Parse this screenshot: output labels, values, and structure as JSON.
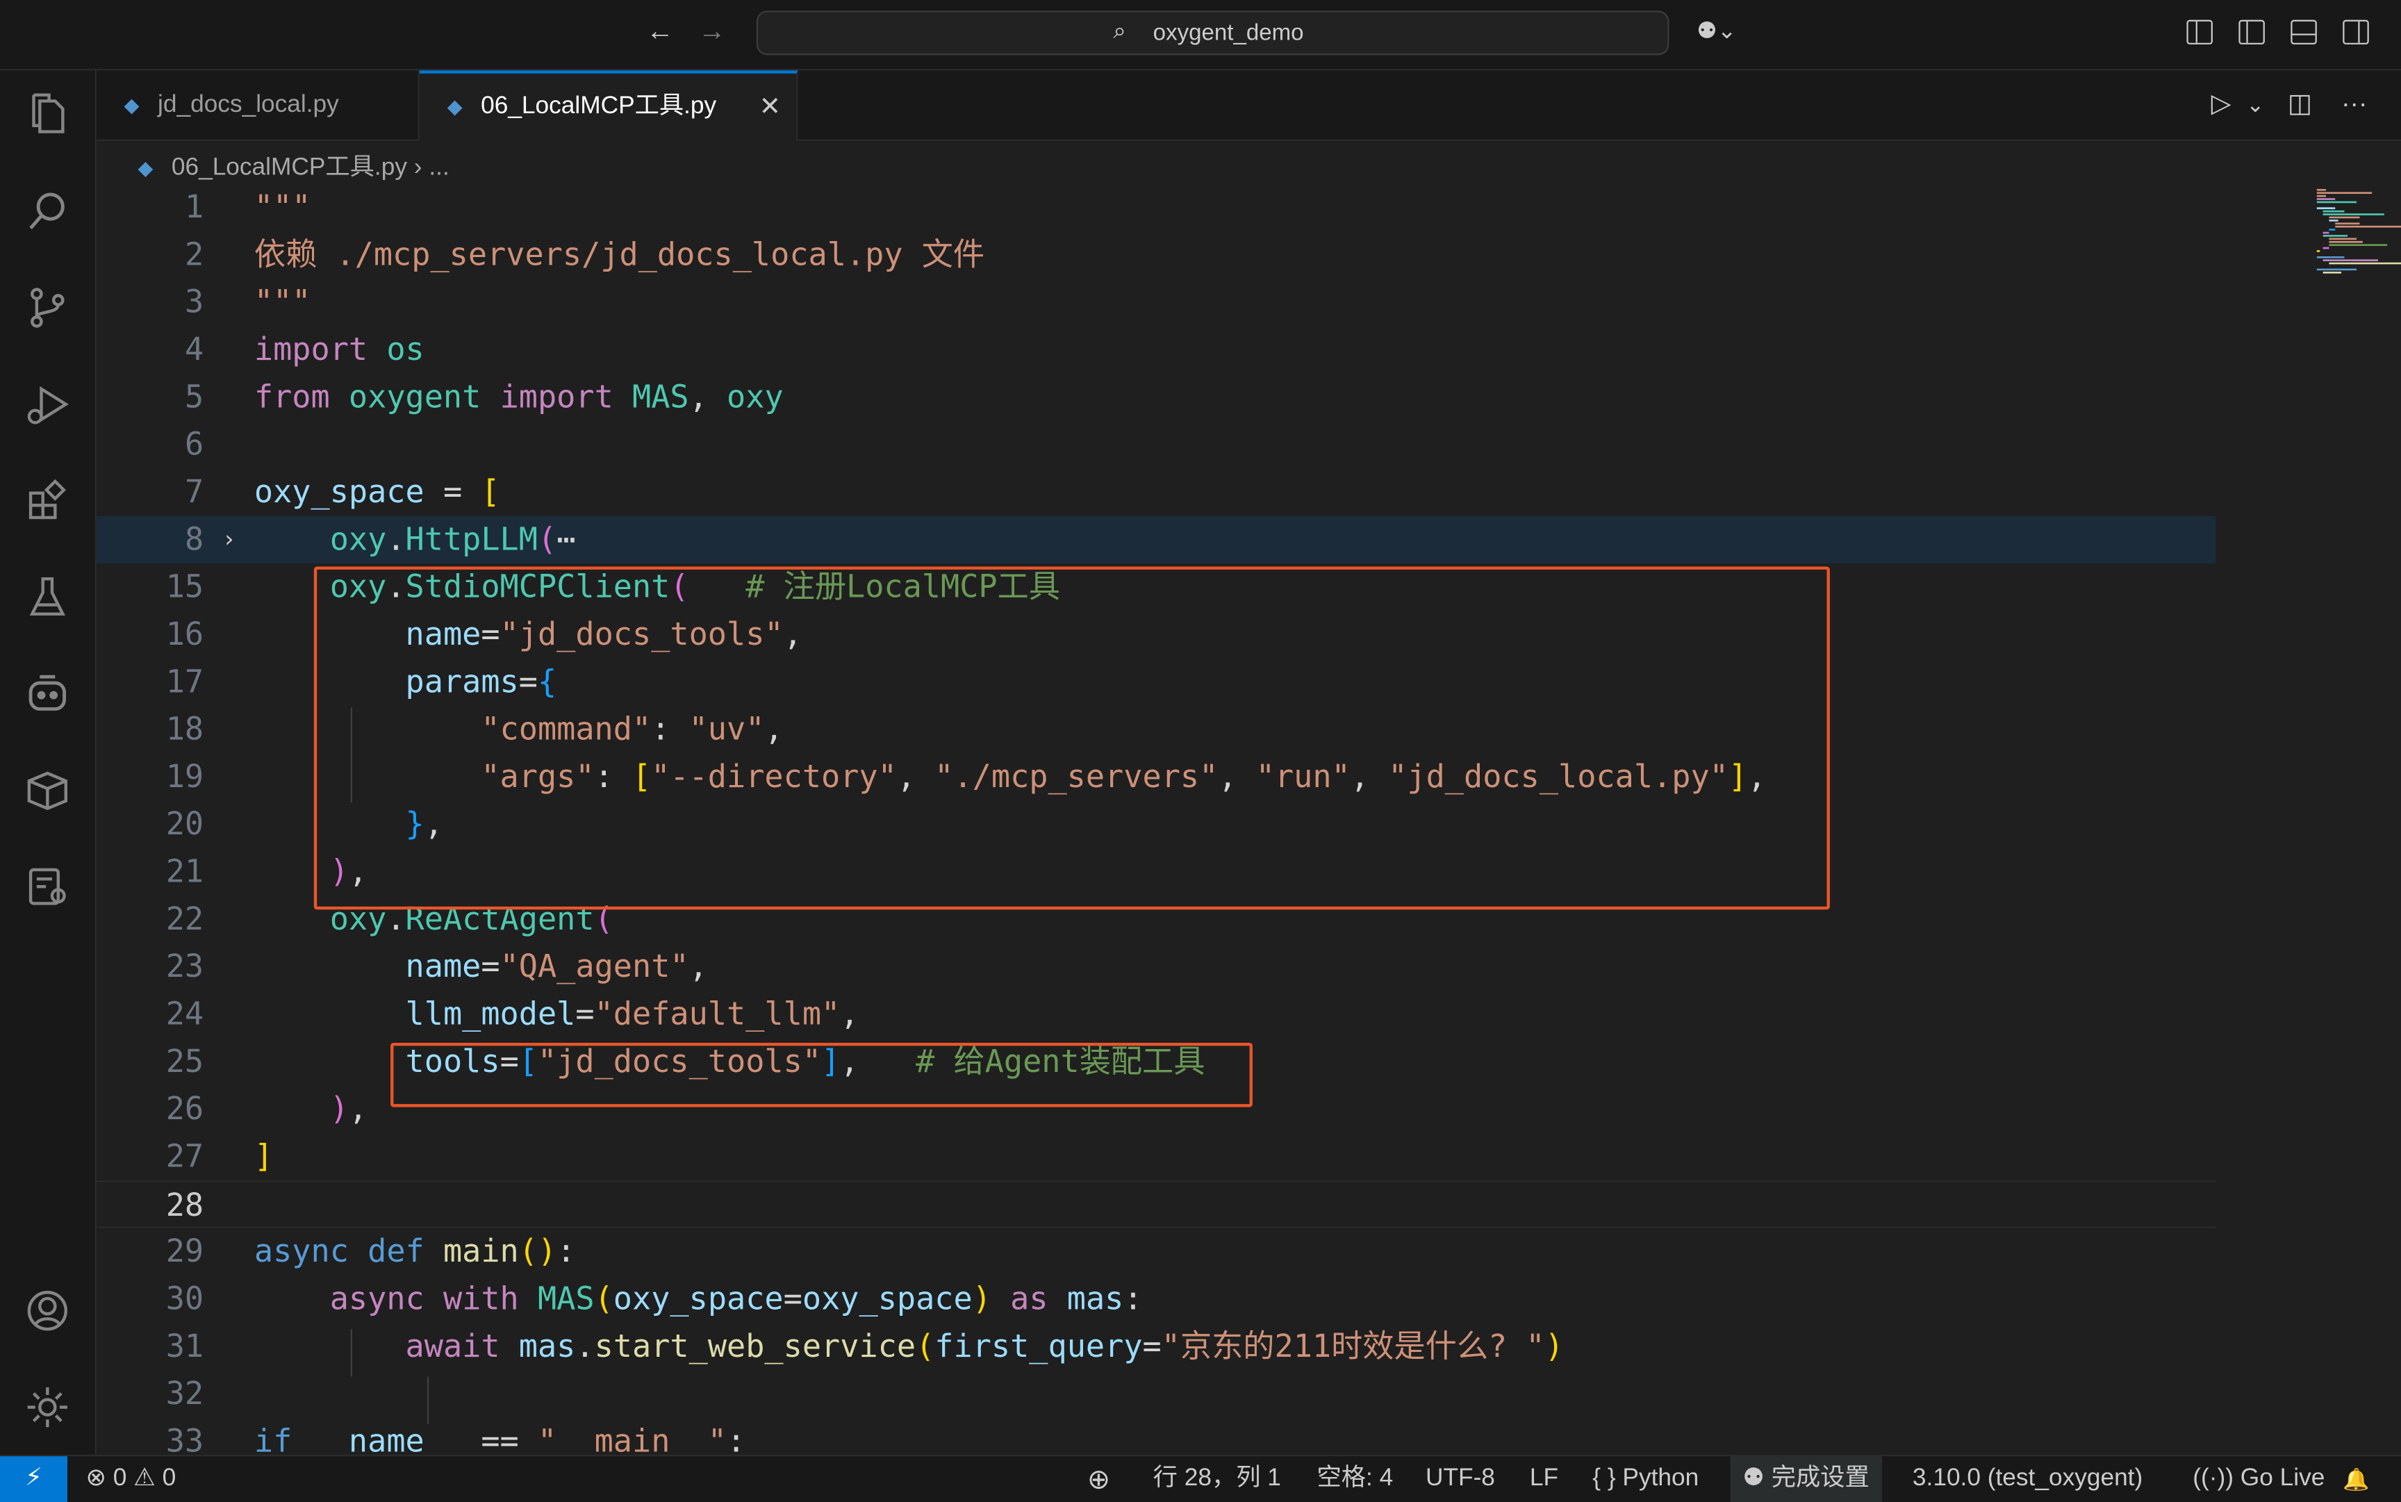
{
  "window": {
    "search_text": "oxygent_demo"
  },
  "titlebar": {
    "back_icon": "←",
    "forward_icon": "→",
    "search_icon": "⌕",
    "copilot_icon": "⚉⌄"
  },
  "tabs": [
    {
      "label": "jd_docs_local.py",
      "active": false
    },
    {
      "label": "06_LocalMCP工具.py",
      "active": true
    }
  ],
  "tab_close": "✕",
  "editor_actions": {
    "run": "▷",
    "run_menu": "⌄",
    "split": "◫",
    "more": "···"
  },
  "breadcrumb": {
    "file": "06_LocalMCP工具.py",
    "sep": "›",
    "more": "..."
  },
  "code": {
    "lines": [
      {
        "n": "1",
        "text": "\"\"\""
      },
      {
        "n": "2",
        "text": "依赖 ./mcp_servers/jd_docs_local.py 文件"
      },
      {
        "n": "3",
        "text": "\"\"\""
      },
      {
        "n": "4",
        "text": "import os"
      },
      {
        "n": "5",
        "text": "from oxygent import MAS, oxy"
      },
      {
        "n": "6",
        "text": ""
      },
      {
        "n": "7",
        "text": "oxy_space = ["
      },
      {
        "n": "8",
        "text": "    oxy.HttpLLM(⋯"
      },
      {
        "n": "15",
        "text": "    oxy.StdioMCPClient(   # 注册LocalMCP工具"
      },
      {
        "n": "16",
        "text": "        name=\"jd_docs_tools\","
      },
      {
        "n": "17",
        "text": "        params={"
      },
      {
        "n": "18",
        "text": "            \"command\": \"uv\","
      },
      {
        "n": "19",
        "text": "            \"args\": [\"--directory\", \"./mcp_servers\", \"run\", \"jd_docs_local.py\"],"
      },
      {
        "n": "20",
        "text": "        },"
      },
      {
        "n": "21",
        "text": "    ),"
      },
      {
        "n": "22",
        "text": "    oxy.ReActAgent("
      },
      {
        "n": "23",
        "text": "        name=\"QA_agent\","
      },
      {
        "n": "24",
        "text": "        llm_model=\"default_llm\","
      },
      {
        "n": "25",
        "text": "        tools=[\"jd_docs_tools\"],   # 给Agent装配工具"
      },
      {
        "n": "26",
        "text": "    ),"
      },
      {
        "n": "27",
        "text": "]"
      },
      {
        "n": "28",
        "text": ""
      },
      {
        "n": "29",
        "text": "async def main():"
      },
      {
        "n": "30",
        "text": "    async with MAS(oxy_space=oxy_space) as mas:"
      },
      {
        "n": "31",
        "text": "        await mas.start_web_service(first_query=\"京东的211时效是什么? \")"
      },
      {
        "n": "32",
        "text": ""
      },
      {
        "n": "33",
        "text": "if __name__ == \"__main__\":"
      }
    ],
    "current_line": "28",
    "folded_line": "8"
  },
  "statusbar": {
    "remote_icon": "⚡",
    "problems": "⊗ 0 ⚠ 0",
    "zoom_icon": "⊕",
    "position": "行 28，列 1",
    "indent": "空格: 4",
    "encoding": "UTF-8",
    "eol": "LF",
    "language": "{ } Python",
    "copilot": "完成设置",
    "interpreter": "3.10.0 (test_oxygent)",
    "golive": "Go Live",
    "bell_icon": "🔔"
  },
  "colors": {
    "accent": "#0078d4",
    "highlight_box": "#e8562a",
    "editor_bg": "#1f1f1f"
  }
}
